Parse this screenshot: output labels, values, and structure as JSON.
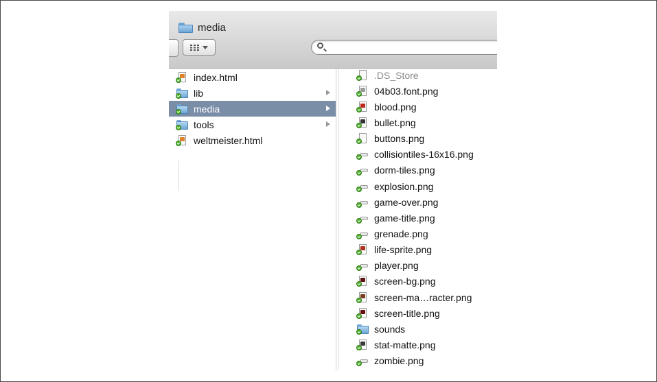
{
  "window": {
    "title": "media",
    "search_placeholder": ""
  },
  "column1": {
    "items": [
      {
        "label": "index.html",
        "kind": "doc",
        "icon": "html-file-icon",
        "color": "#e0822c"
      },
      {
        "label": "lib",
        "kind": "folder",
        "icon": "folder-icon"
      },
      {
        "label": "media",
        "kind": "folder",
        "icon": "folder-icon",
        "selected": true
      },
      {
        "label": "tools",
        "kind": "folder",
        "icon": "folder-icon"
      },
      {
        "label": "weltmeister.html",
        "kind": "doc",
        "icon": "html-file-icon",
        "color": "#e0822c"
      }
    ]
  },
  "column2": {
    "items": [
      {
        "label": ".DS_Store",
        "kind": "doc",
        "icon": "file-icon",
        "muted": true
      },
      {
        "label": "04b03.font.png",
        "kind": "doc",
        "icon": "image-file-icon",
        "color": "#9b9b9b"
      },
      {
        "label": "blood.png",
        "kind": "doc",
        "icon": "image-file-icon",
        "color": "#c0281c"
      },
      {
        "label": "bullet.png",
        "kind": "doc",
        "icon": "image-file-icon",
        "color": "#333333"
      },
      {
        "label": "buttons.png",
        "kind": "doc",
        "icon": "image-file-icon",
        "color": "#f5f5f5"
      },
      {
        "label": "collisiontiles-16x16.png",
        "kind": "tag",
        "icon": "image-file-icon"
      },
      {
        "label": "dorm-tiles.png",
        "kind": "tag",
        "icon": "image-file-icon"
      },
      {
        "label": "explosion.png",
        "kind": "tag",
        "icon": "image-file-icon"
      },
      {
        "label": "game-over.png",
        "kind": "tag",
        "icon": "image-file-icon"
      },
      {
        "label": "game-title.png",
        "kind": "tag",
        "icon": "image-file-icon"
      },
      {
        "label": "grenade.png",
        "kind": "tag",
        "icon": "image-file-icon"
      },
      {
        "label": "life-sprite.png",
        "kind": "doc",
        "icon": "image-file-icon",
        "color": "#b03020"
      },
      {
        "label": "player.png",
        "kind": "tag",
        "icon": "image-file-icon"
      },
      {
        "label": "screen-bg.png",
        "kind": "doc",
        "icon": "image-file-icon",
        "color": "#5a1414"
      },
      {
        "label": "screen-ma…racter.png",
        "kind": "doc",
        "icon": "image-file-icon",
        "color": "#7a3c20"
      },
      {
        "label": "screen-title.png",
        "kind": "doc",
        "icon": "image-file-icon",
        "color": "#6a1010"
      },
      {
        "label": "sounds",
        "kind": "folder",
        "icon": "folder-icon"
      },
      {
        "label": "stat-matte.png",
        "kind": "doc",
        "icon": "image-file-icon",
        "color": "#3a3a3a"
      },
      {
        "label": "zombie.png",
        "kind": "tag",
        "icon": "image-file-icon"
      }
    ]
  }
}
